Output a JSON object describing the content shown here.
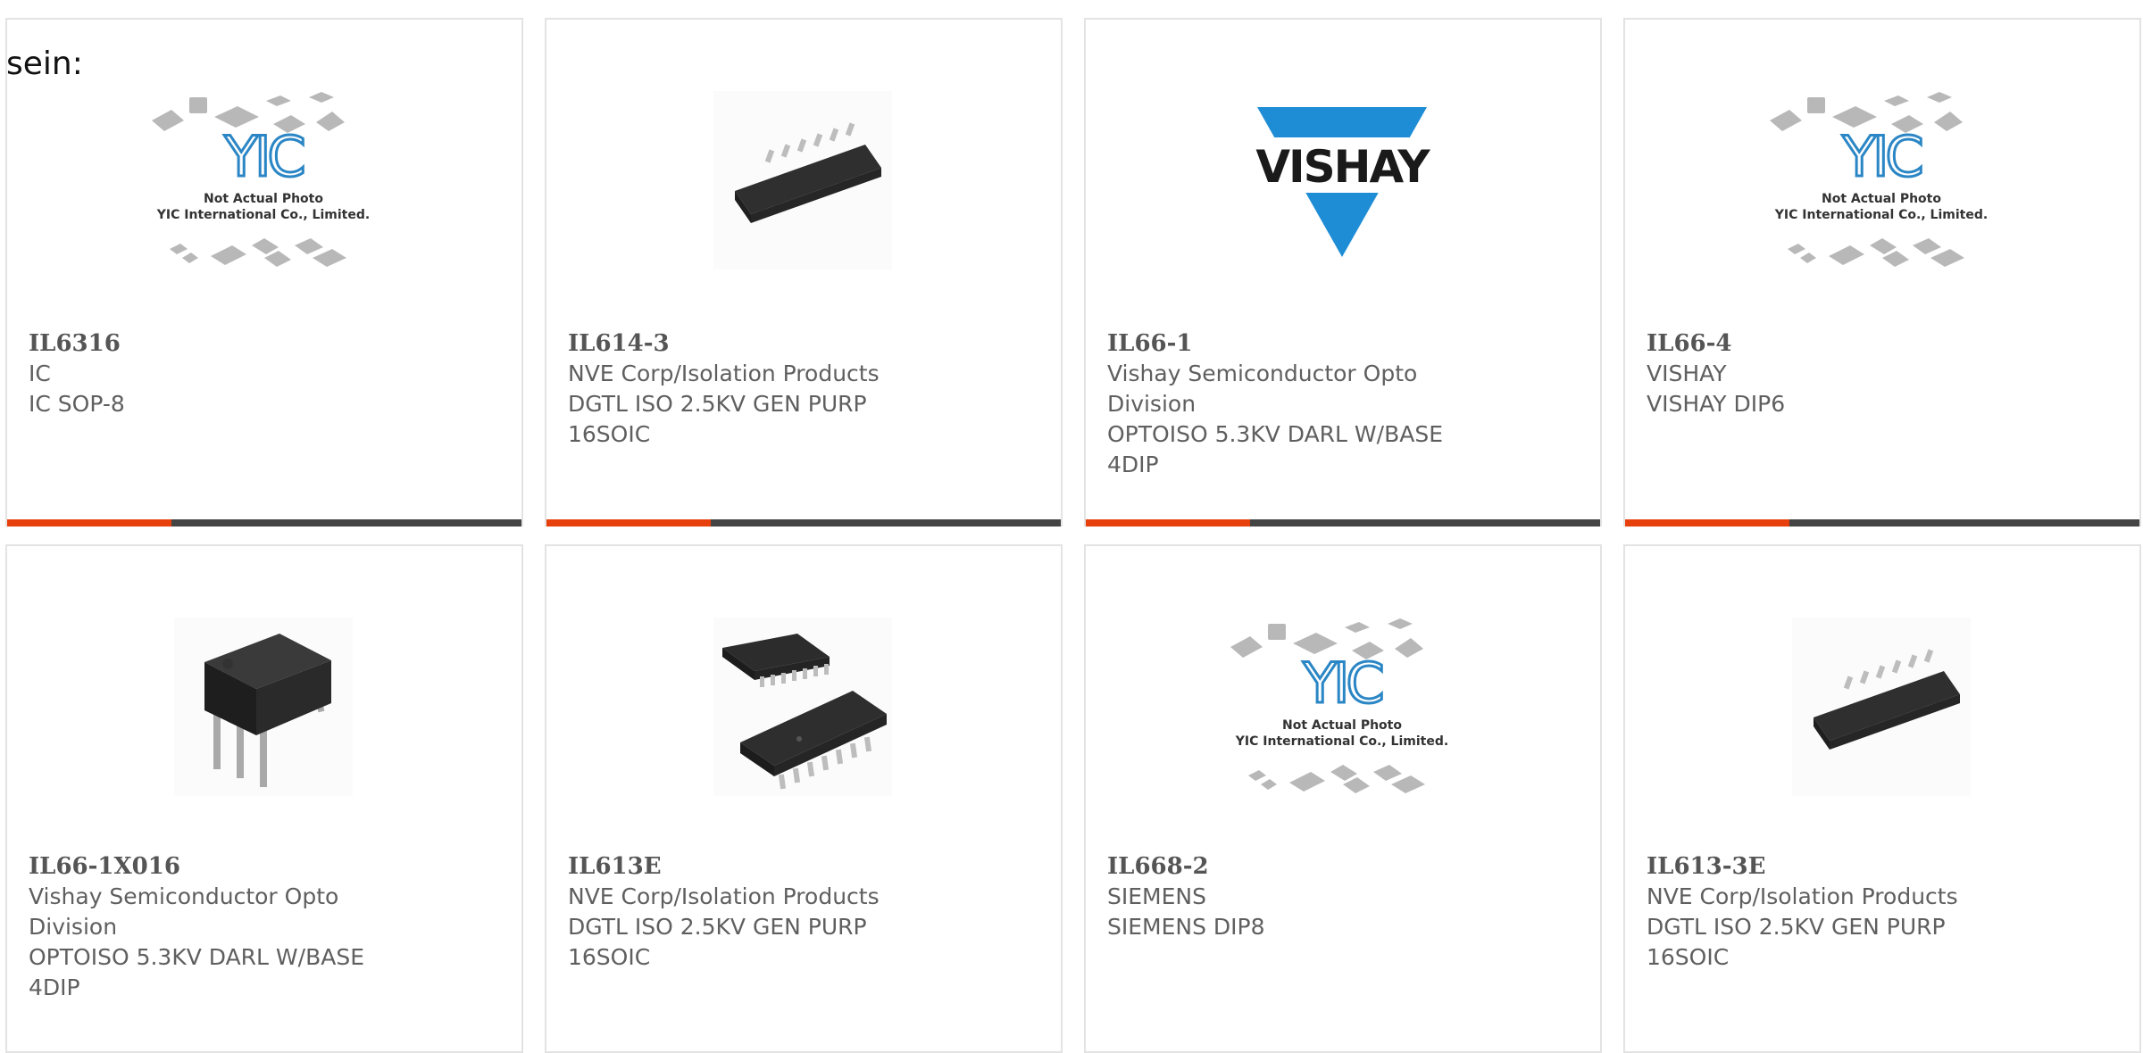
{
  "intro_text": "sein:",
  "products": [
    {
      "part_number": "IL6316",
      "manufacturer": "IC",
      "description": "IC SOP-8",
      "image": "yic-placeholder"
    },
    {
      "part_number": "IL614-3",
      "manufacturer": "NVE Corp/Isolation Products",
      "description": "DGTL ISO 2.5KV GEN PURP 16SOIC",
      "image": "soic-16-chip"
    },
    {
      "part_number": "IL66-1",
      "manufacturer": "Vishay Semiconductor Opto Division",
      "description": "OPTOISO 5.3KV DARL W/BASE 4DIP",
      "image": "vishay-logo"
    },
    {
      "part_number": "IL66-4",
      "manufacturer": "VISHAY",
      "description": "VISHAY DIP6",
      "image": "yic-placeholder"
    },
    {
      "part_number": "IL66-1X016",
      "manufacturer": "Vishay Semiconductor Opto Division",
      "description": "OPTOISO 5.3KV DARL W/BASE 4DIP",
      "image": "dip-6-chip"
    },
    {
      "part_number": "IL613E",
      "manufacturer": "NVE Corp/Isolation Products",
      "description": "DGTL ISO 2.5KV GEN PURP 16SOIC",
      "image": "soic-16-pair"
    },
    {
      "part_number": "IL668-2",
      "manufacturer": "SIEMENS",
      "description": "SIEMENS DIP8",
      "image": "yic-placeholder"
    },
    {
      "part_number": "IL613-3E",
      "manufacturer": "NVE Corp/Isolation Products",
      "description": "DGTL ISO 2.5KV GEN PURP 16SOIC",
      "image": "soic-16-chip"
    }
  ],
  "placeholder": {
    "brand": "YIC",
    "line1": "Not Actual Photo",
    "line2": "YIC International Co., Limited."
  },
  "vishay_logo_text": "VISHAY",
  "colors": {
    "accent": "#e8400c",
    "bar_dark": "#444444",
    "vishay_blue": "#1f8dd6",
    "yic_blue": "#2b86c5"
  }
}
